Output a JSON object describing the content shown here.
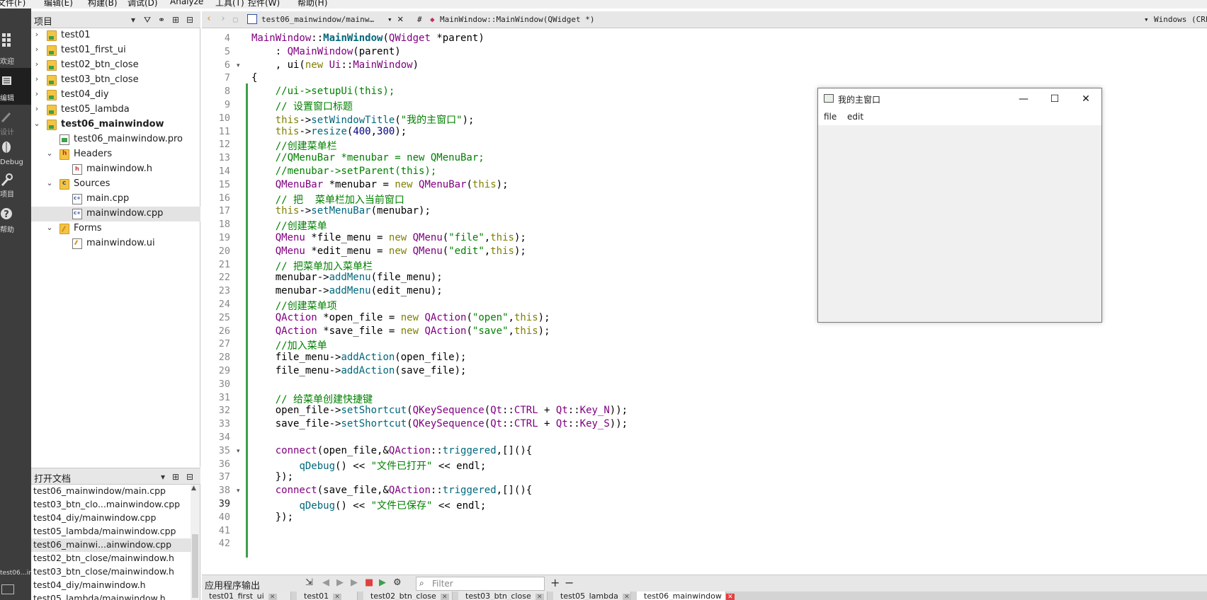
{
  "menubar": [
    "文件(F)",
    "编辑(E)",
    "构建(B)",
    "调试(D)",
    "Analyze",
    "工具(T)",
    "控件(W)",
    "帮助(H)"
  ],
  "modes": [
    {
      "label": "欢迎",
      "icon": "grid-icon"
    },
    {
      "label": "编辑",
      "icon": "edit-icon"
    },
    {
      "label": "设计",
      "icon": "design-icon"
    },
    {
      "label": "Debug",
      "icon": "bug-icon"
    },
    {
      "label": "项目",
      "icon": "wrench-icon"
    },
    {
      "label": "帮助",
      "icon": "help-icon"
    }
  ],
  "mode_bottom_label": "test06…indow",
  "project": {
    "title": "项目",
    "tree": [
      {
        "label": "test01",
        "level": 0,
        "arrow": "›",
        "icon": "folder"
      },
      {
        "label": "test01_first_ui",
        "level": 0,
        "arrow": "›",
        "icon": "folder"
      },
      {
        "label": "test02_btn_close",
        "level": 0,
        "arrow": "›",
        "icon": "folder"
      },
      {
        "label": "test03_btn_close",
        "level": 0,
        "arrow": "›",
        "icon": "folder"
      },
      {
        "label": "test04_diy",
        "level": 0,
        "arrow": "›",
        "icon": "folder"
      },
      {
        "label": "test05_lambda",
        "level": 0,
        "arrow": "›",
        "icon": "folder"
      },
      {
        "label": "test06_mainwindow",
        "level": 0,
        "arrow": "⌄",
        "icon": "folder",
        "bold": true
      },
      {
        "label": "test06_mainwindow.pro",
        "level": 1,
        "arrow": "",
        "icon": "file-pro"
      },
      {
        "label": "Headers",
        "level": 1,
        "arrow": "⌄",
        "icon": "folder-h"
      },
      {
        "label": "mainwindow.h",
        "level": 2,
        "arrow": "",
        "icon": "file-h"
      },
      {
        "label": "Sources",
        "level": 1,
        "arrow": "⌄",
        "icon": "folder-c"
      },
      {
        "label": "main.cpp",
        "level": 2,
        "arrow": "",
        "icon": "file-cpp"
      },
      {
        "label": "mainwindow.cpp",
        "level": 2,
        "arrow": "",
        "icon": "file-cpp",
        "selected": true
      },
      {
        "label": "Forms",
        "level": 1,
        "arrow": "⌄",
        "icon": "folder-f"
      },
      {
        "label": "mainwindow.ui",
        "level": 2,
        "arrow": "",
        "icon": "file-ui"
      }
    ]
  },
  "open_docs": {
    "title": "打开文档",
    "items": [
      {
        "label": "test06_mainwindow/main.cpp"
      },
      {
        "label": "test03_btn_clo...mainwindow.cpp"
      },
      {
        "label": "test04_diy/mainwindow.cpp"
      },
      {
        "label": "test05_lambda/mainwindow.cpp"
      },
      {
        "label": "test06_mainwi...ainwindow.cpp",
        "selected": true
      },
      {
        "label": "test02_btn_close/mainwindow.h"
      },
      {
        "label": "test03_btn_close/mainwindow.h"
      },
      {
        "label": "test04_diy/mainwindow.h"
      },
      {
        "label": "test05_lambda/mainwindow.h"
      }
    ]
  },
  "editor_toolbar": {
    "file_tab": "test06_mainwindow/mainw…",
    "hash": "#",
    "symbol": "MainWindow::MainWindow(QWidget *)",
    "encoding": "Windows (CRLF)"
  },
  "current_line": 39,
  "code": [
    {
      "n": 4,
      "fold": "",
      "parts": [
        [
          "t",
          "MainWindow"
        ],
        [
          "",
          "::"
        ],
        [
          "fb",
          "MainWindow"
        ],
        [
          "",
          "("
        ],
        [
          "t",
          "QWidget"
        ],
        [
          "",
          " *parent)"
        ]
      ]
    },
    {
      "n": 5,
      "fold": "",
      "parts": [
        [
          "",
          "    : "
        ],
        [
          "t",
          "QMainWindow"
        ],
        [
          "",
          "(parent)"
        ]
      ]
    },
    {
      "n": 6,
      "fold": "▾",
      "parts": [
        [
          "",
          "    , ui("
        ],
        [
          "k",
          "new"
        ],
        [
          "",
          " "
        ],
        [
          "t",
          "Ui"
        ],
        [
          "",
          "::"
        ],
        [
          "t",
          "MainWindow"
        ],
        [
          "",
          ")"
        ]
      ]
    },
    {
      "n": 7,
      "fold": "",
      "parts": [
        [
          "",
          "{"
        ]
      ]
    },
    {
      "n": 8,
      "fold": "",
      "parts": [
        [
          "c",
          "    //ui->setupUi(this);"
        ]
      ]
    },
    {
      "n": 9,
      "fold": "",
      "parts": [
        [
          "c",
          "    // 设置窗口标题"
        ]
      ]
    },
    {
      "n": 10,
      "fold": "",
      "parts": [
        [
          "",
          "    "
        ],
        [
          "k",
          "this"
        ],
        [
          "",
          "->"
        ],
        [
          "f",
          "setWindowTitle"
        ],
        [
          "",
          "("
        ],
        [
          "s",
          "\"我的主窗口\""
        ],
        [
          "",
          ");"
        ]
      ]
    },
    {
      "n": 11,
      "fold": "",
      "parts": [
        [
          "",
          "    "
        ],
        [
          "k",
          "this"
        ],
        [
          "",
          "->"
        ],
        [
          "f",
          "resize"
        ],
        [
          "",
          "("
        ],
        [
          "n",
          "400"
        ],
        [
          "",
          ","
        ],
        [
          "n",
          "300"
        ],
        [
          "",
          ");"
        ]
      ]
    },
    {
      "n": 12,
      "fold": "",
      "parts": [
        [
          "c",
          "    //创建菜单栏"
        ]
      ]
    },
    {
      "n": 13,
      "fold": "",
      "parts": [
        [
          "c",
          "    //QMenuBar *menubar = new QMenuBar;"
        ]
      ]
    },
    {
      "n": 14,
      "fold": "",
      "parts": [
        [
          "c",
          "    //menubar->setParent(this);"
        ]
      ]
    },
    {
      "n": 15,
      "fold": "",
      "parts": [
        [
          "",
          "    "
        ],
        [
          "t",
          "QMenuBar"
        ],
        [
          "",
          " *menubar = "
        ],
        [
          "k",
          "new"
        ],
        [
          "",
          " "
        ],
        [
          "t",
          "QMenuBar"
        ],
        [
          "",
          "("
        ],
        [
          "k",
          "this"
        ],
        [
          "",
          ");"
        ]
      ]
    },
    {
      "n": 16,
      "fold": "",
      "parts": [
        [
          "c",
          "    // 把  菜单栏加入当前窗口"
        ]
      ]
    },
    {
      "n": 17,
      "fold": "",
      "parts": [
        [
          "",
          "    "
        ],
        [
          "k",
          "this"
        ],
        [
          "",
          "->"
        ],
        [
          "f",
          "setMenuBar"
        ],
        [
          "",
          "(menubar);"
        ]
      ]
    },
    {
      "n": 18,
      "fold": "",
      "parts": [
        [
          "c",
          "    //创建菜单"
        ]
      ]
    },
    {
      "n": 19,
      "fold": "",
      "parts": [
        [
          "",
          "    "
        ],
        [
          "t",
          "QMenu"
        ],
        [
          "",
          " *file_menu = "
        ],
        [
          "k",
          "new"
        ],
        [
          "",
          " "
        ],
        [
          "t",
          "QMenu"
        ],
        [
          "",
          "("
        ],
        [
          "s",
          "\"file\""
        ],
        [
          "",
          ","
        ],
        [
          "k",
          "this"
        ],
        [
          "",
          ");"
        ]
      ]
    },
    {
      "n": 20,
      "fold": "",
      "parts": [
        [
          "",
          "    "
        ],
        [
          "t",
          "QMenu"
        ],
        [
          "",
          " *edit_menu = "
        ],
        [
          "k",
          "new"
        ],
        [
          "",
          " "
        ],
        [
          "t",
          "QMenu"
        ],
        [
          "",
          "("
        ],
        [
          "s",
          "\"edit\""
        ],
        [
          "",
          ","
        ],
        [
          "k",
          "this"
        ],
        [
          "",
          ");"
        ]
      ]
    },
    {
      "n": 21,
      "fold": "",
      "parts": [
        [
          "c",
          "    // 把菜单加入菜单栏"
        ]
      ]
    },
    {
      "n": 22,
      "fold": "",
      "parts": [
        [
          "",
          "    menubar->"
        ],
        [
          "f",
          "addMenu"
        ],
        [
          "",
          "(file_menu);"
        ]
      ]
    },
    {
      "n": 23,
      "fold": "",
      "parts": [
        [
          "",
          "    menubar->"
        ],
        [
          "f",
          "addMenu"
        ],
        [
          "",
          "(edit_menu);"
        ]
      ]
    },
    {
      "n": 24,
      "fold": "",
      "parts": [
        [
          "c",
          "    //创建菜单项"
        ]
      ]
    },
    {
      "n": 25,
      "fold": "",
      "parts": [
        [
          "",
          "    "
        ],
        [
          "t",
          "QAction"
        ],
        [
          "",
          " *open_file = "
        ],
        [
          "k",
          "new"
        ],
        [
          "",
          " "
        ],
        [
          "t",
          "QAction"
        ],
        [
          "",
          "("
        ],
        [
          "s",
          "\"open\""
        ],
        [
          "",
          ","
        ],
        [
          "k",
          "this"
        ],
        [
          "",
          ");"
        ]
      ]
    },
    {
      "n": 26,
      "fold": "",
      "parts": [
        [
          "",
          "    "
        ],
        [
          "t",
          "QAction"
        ],
        [
          "",
          " *save_file = "
        ],
        [
          "k",
          "new"
        ],
        [
          "",
          " "
        ],
        [
          "t",
          "QAction"
        ],
        [
          "",
          "("
        ],
        [
          "s",
          "\"save\""
        ],
        [
          "",
          ","
        ],
        [
          "k",
          "this"
        ],
        [
          "",
          ");"
        ]
      ]
    },
    {
      "n": 27,
      "fold": "",
      "parts": [
        [
          "c",
          "    //加入菜单"
        ]
      ]
    },
    {
      "n": 28,
      "fold": "",
      "parts": [
        [
          "",
          "    file_menu->"
        ],
        [
          "f",
          "addAction"
        ],
        [
          "",
          "(open_file);"
        ]
      ]
    },
    {
      "n": 29,
      "fold": "",
      "parts": [
        [
          "",
          "    file_menu->"
        ],
        [
          "f",
          "addAction"
        ],
        [
          "",
          "(save_file);"
        ]
      ]
    },
    {
      "n": 30,
      "fold": "",
      "parts": [
        [
          "",
          ""
        ]
      ]
    },
    {
      "n": 31,
      "fold": "",
      "parts": [
        [
          "c",
          "    // 给菜单创建快捷键"
        ]
      ]
    },
    {
      "n": 32,
      "fold": "",
      "parts": [
        [
          "",
          "    open_file->"
        ],
        [
          "f",
          "setShortcut"
        ],
        [
          "",
          "("
        ],
        [
          "t",
          "QKeySequence"
        ],
        [
          "",
          "("
        ],
        [
          "t",
          "Qt"
        ],
        [
          "",
          "::"
        ],
        [
          "e",
          "CTRL"
        ],
        [
          "",
          " + "
        ],
        [
          "t",
          "Qt"
        ],
        [
          "",
          "::"
        ],
        [
          "e",
          "Key_N"
        ],
        [
          "",
          "));"
        ]
      ]
    },
    {
      "n": 33,
      "fold": "",
      "parts": [
        [
          "",
          "    save_file->"
        ],
        [
          "f",
          "setShortcut"
        ],
        [
          "",
          "("
        ],
        [
          "t",
          "QKeySequence"
        ],
        [
          "",
          "("
        ],
        [
          "t",
          "Qt"
        ],
        [
          "",
          "::"
        ],
        [
          "e",
          "CTRL"
        ],
        [
          "",
          " + "
        ],
        [
          "t",
          "Qt"
        ],
        [
          "",
          "::"
        ],
        [
          "e",
          "Key_S"
        ],
        [
          "",
          "));"
        ]
      ]
    },
    {
      "n": 34,
      "fold": "",
      "parts": [
        [
          "",
          ""
        ]
      ]
    },
    {
      "n": 35,
      "fold": "▾",
      "parts": [
        [
          "",
          "    "
        ],
        [
          "m",
          "connect"
        ],
        [
          "",
          "(open_file,&"
        ],
        [
          "t",
          "QAction"
        ],
        [
          "",
          "::"
        ],
        [
          "f",
          "triggered"
        ],
        [
          "",
          ",[](){"
        ]
      ]
    },
    {
      "n": 36,
      "fold": "",
      "parts": [
        [
          "",
          "        "
        ],
        [
          "f",
          "qDebug"
        ],
        [
          "",
          "() << "
        ],
        [
          "s",
          "\"文件已打开\""
        ],
        [
          "",
          " << endl;"
        ]
      ]
    },
    {
      "n": 37,
      "fold": "",
      "parts": [
        [
          "",
          "    });"
        ]
      ]
    },
    {
      "n": 38,
      "fold": "▾",
      "parts": [
        [
          "",
          "    "
        ],
        [
          "m",
          "connect"
        ],
        [
          "",
          "(save_file,&"
        ],
        [
          "t",
          "QAction"
        ],
        [
          "",
          "::"
        ],
        [
          "f",
          "triggered"
        ],
        [
          "",
          ",[](){"
        ]
      ]
    },
    {
      "n": 39,
      "fold": "",
      "parts": [
        [
          "",
          "        "
        ],
        [
          "f",
          "qDebug"
        ],
        [
          "",
          "() << "
        ],
        [
          "s",
          "\"文件已保存\""
        ],
        [
          "",
          " << endl;"
        ]
      ]
    },
    {
      "n": 40,
      "fold": "",
      "parts": [
        [
          "",
          "    });"
        ]
      ]
    },
    {
      "n": 41,
      "fold": "",
      "parts": [
        [
          "",
          ""
        ]
      ]
    },
    {
      "n": 42,
      "fold": "",
      "parts": [
        [
          "",
          ""
        ]
      ]
    }
  ],
  "preview_window": {
    "title": "我的主窗口",
    "menus": [
      "file",
      "edit"
    ],
    "minimize": "—",
    "maximize": "☐",
    "close": "✕"
  },
  "output": {
    "title": "应用程序输出",
    "filter_placeholder": "Filter",
    "tabs": [
      {
        "label": "test01_first_ui"
      },
      {
        "label": "test01"
      },
      {
        "label": "test02_btn_close"
      },
      {
        "label": "test03_btn_close"
      },
      {
        "label": "test05_lambda"
      },
      {
        "label": "test06_mainwindow",
        "active": true
      }
    ]
  }
}
